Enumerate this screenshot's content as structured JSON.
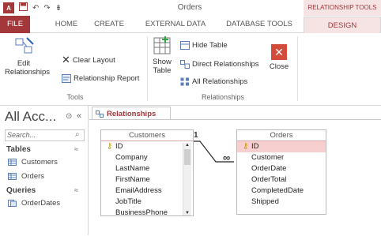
{
  "window": {
    "title": "Orders",
    "logo": "A",
    "quick_access": [
      "save-icon",
      "undo-icon",
      "redo-icon",
      "customize-icon"
    ],
    "contextual_tools": "RELATIONSHIP TOOLS"
  },
  "ribbon_tabs": [
    "FILE",
    "HOME",
    "CREATE",
    "EXTERNAL DATA",
    "DATABASE TOOLS",
    "DESIGN"
  ],
  "ribbon": {
    "tools": {
      "edit_relationships": [
        "Edit",
        "Relationships"
      ],
      "clear_layout": "Clear Layout",
      "relationship_report": "Relationship Report",
      "label": "Tools"
    },
    "relationships": {
      "show_table": [
        "Show",
        "Table"
      ],
      "hide_table": "Hide Table",
      "direct_relationships": "Direct Relationships",
      "all_relationships": "All Relationships",
      "close": "Close",
      "label": "Relationships"
    }
  },
  "nav": {
    "title": "All Acc...",
    "search_placeholder": "Search...",
    "tables_header": "Tables",
    "tables": [
      "Customers",
      "Orders"
    ],
    "queries_header": "Queries",
    "queries": [
      "OrderDates"
    ]
  },
  "document_tab": "Relationships",
  "relationship_cardinality": {
    "one": "1",
    "many": "∞"
  },
  "tables": {
    "customers": {
      "title": "Customers",
      "fields": [
        "ID",
        "Company",
        "LastName",
        "FirstName",
        "EmailAddress",
        "JobTitle",
        "BusinessPhone"
      ]
    },
    "orders": {
      "title": "Orders",
      "fields": [
        "ID",
        "Customer",
        "OrderDate",
        "OrderTotal",
        "CompletedDate",
        "Shipped"
      ]
    }
  },
  "colors": {
    "accent": "#a4373a",
    "context_bg": "#f6e3e3",
    "selected_field": "#f7cfcf"
  }
}
